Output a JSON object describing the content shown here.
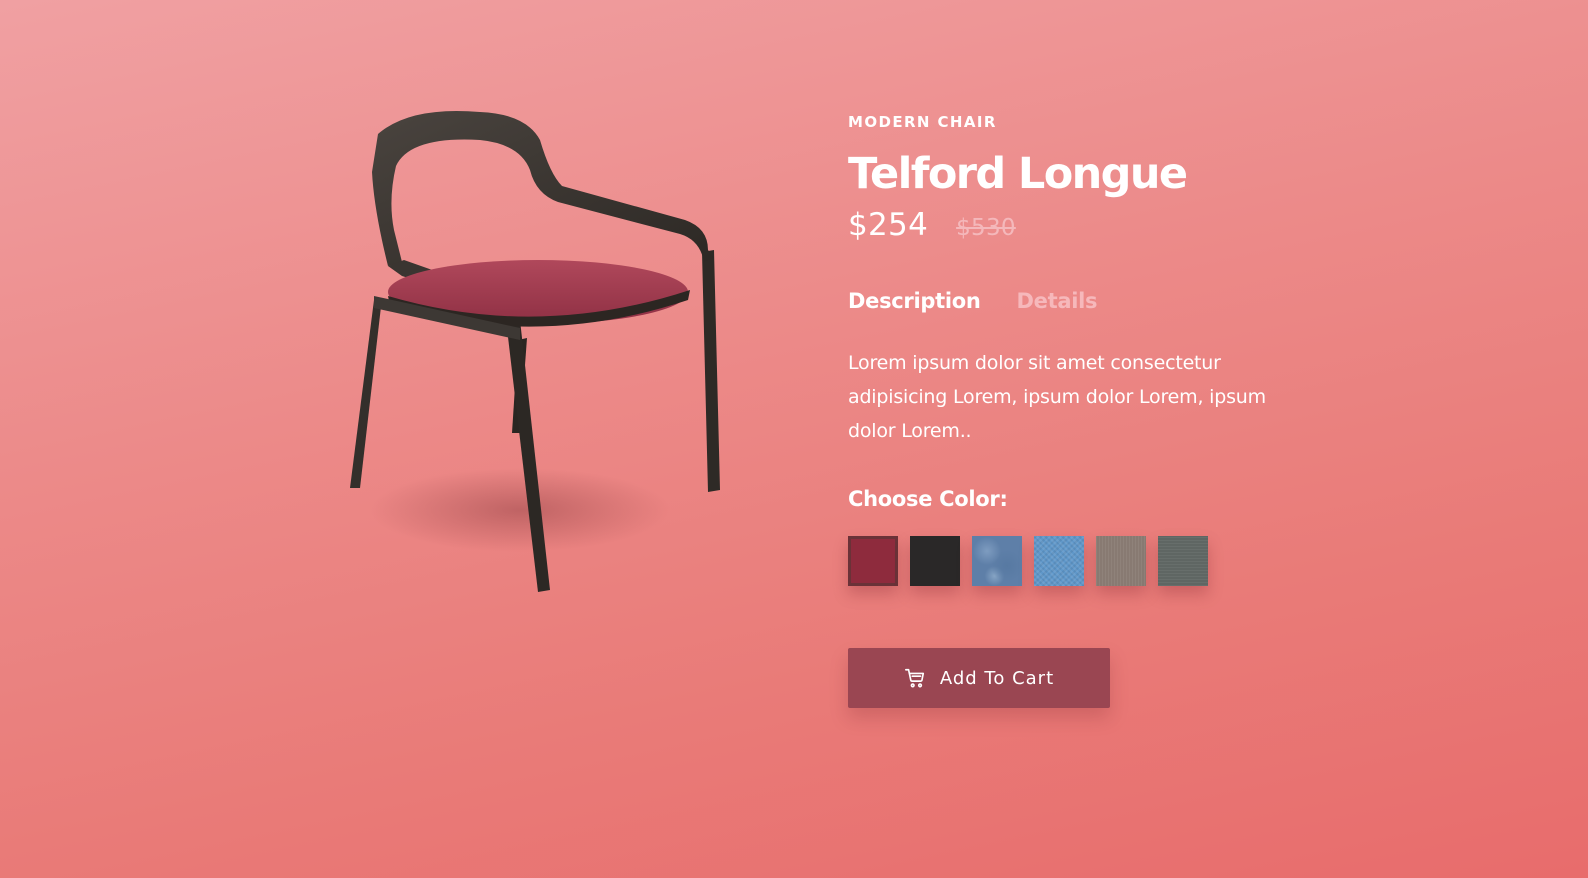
{
  "product": {
    "category": "MODERN CHAIR",
    "title": "Telford Longue",
    "price": "$254",
    "old_price": "$530",
    "description": "Lorem ipsum dolor sit amet consectetur adipisicing Lorem, ipsum dolor Lorem, ipsum dolor Lorem.."
  },
  "tabs": [
    {
      "label": "Description",
      "active": true
    },
    {
      "label": "Details",
      "active": false
    }
  ],
  "colors": {
    "label": "Choose Color:",
    "selected": "red",
    "swatches": [
      {
        "name": "red",
        "color": "#8e2b3d"
      },
      {
        "name": "black",
        "color": "#2a2828"
      },
      {
        "name": "denim",
        "color": "#5e7fa8"
      },
      {
        "name": "blue",
        "color": "#5f97c9"
      },
      {
        "name": "taupe",
        "color": "#887a72"
      },
      {
        "name": "slate",
        "color": "#5f6663"
      }
    ]
  },
  "cart": {
    "icon": "cart-icon",
    "label": "Add To Cart"
  },
  "theme": {
    "background_top": "#f0a0a2",
    "background_bottom": "#e86c6c",
    "button_color": "#9a4652"
  }
}
